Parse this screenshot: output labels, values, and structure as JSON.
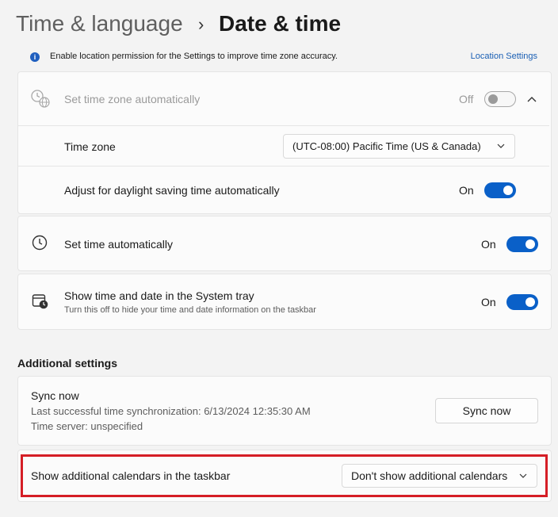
{
  "header": {
    "parent": "Time & language",
    "separator": "›",
    "title": "Date & time"
  },
  "info_bar": {
    "message": "Enable location permission for the Settings to improve time zone accuracy.",
    "link": "Location Settings"
  },
  "time_zone_auto": {
    "label": "Set time zone automatically",
    "state": "Off",
    "time_zone_label": "Time zone",
    "time_zone_value": "(UTC-08:00) Pacific Time (US & Canada)",
    "dst_label": "Adjust for daylight saving time automatically",
    "dst_state": "On"
  },
  "set_time_auto": {
    "label": "Set time automatically",
    "state": "On"
  },
  "system_tray": {
    "label": "Show time and date in the System tray",
    "sub": "Turn this off to hide your time and date information on the taskbar",
    "state": "On"
  },
  "additional": {
    "heading": "Additional settings",
    "sync_label": "Sync now",
    "sync_last": "Last successful time synchronization: 6/13/2024 12:35:30 AM",
    "sync_server": "Time server: unspecified",
    "sync_button": "Sync now",
    "calendars_label": "Show additional calendars in the taskbar",
    "calendars_value": "Don't show additional calendars"
  },
  "colors": {
    "accent": "#0a60c8",
    "highlight": "#d51e26",
    "link": "#1a5fb4"
  }
}
